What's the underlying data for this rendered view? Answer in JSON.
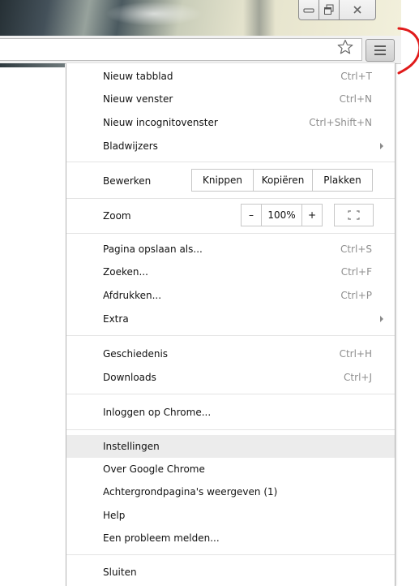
{
  "window": {
    "controls": [
      "minimize-icon",
      "restore-icon",
      "close-icon"
    ]
  },
  "toolbar": {
    "bookmark_icon": "star-icon",
    "menu_icon": "hamburger-menu-icon"
  },
  "annotation": {
    "color": "#e01b1b"
  },
  "menu": {
    "items_top": [
      {
        "label": "Nieuw tabblad",
        "shortcut": "Ctrl+T"
      },
      {
        "label": "Nieuw venster",
        "shortcut": "Ctrl+N"
      },
      {
        "label": "Nieuw incognitovenster",
        "shortcut": "Ctrl+Shift+N"
      },
      {
        "label": "Bladwijzers",
        "shortcut": ""
      }
    ],
    "edit": {
      "label": "Bewerken",
      "cut": "Knippen",
      "copy": "Kopiëren",
      "paste": "Plakken"
    },
    "zoom": {
      "label": "Zoom",
      "minus": "–",
      "value": "100%",
      "plus": "+",
      "fullscreen_icon": "fullscreen-icon"
    },
    "items_mid": [
      {
        "label": "Pagina opslaan als...",
        "shortcut": "Ctrl+S"
      },
      {
        "label": "Zoeken...",
        "shortcut": "Ctrl+F"
      },
      {
        "label": "Afdrukken...",
        "shortcut": "Ctrl+P"
      },
      {
        "label": "Extra",
        "shortcut": ""
      }
    ],
    "items_history": [
      {
        "label": "Geschiedenis",
        "shortcut": "Ctrl+H"
      },
      {
        "label": "Downloads",
        "shortcut": "Ctrl+J"
      }
    ],
    "signin": "Inloggen op Chrome...",
    "items_settings": [
      {
        "label": "Instellingen"
      },
      {
        "label": "Over Google Chrome"
      },
      {
        "label": "Achtergrondpagina's weergeven (1)"
      },
      {
        "label": "Help"
      },
      {
        "label": "Een probleem melden..."
      }
    ],
    "exit": "Sluiten"
  }
}
